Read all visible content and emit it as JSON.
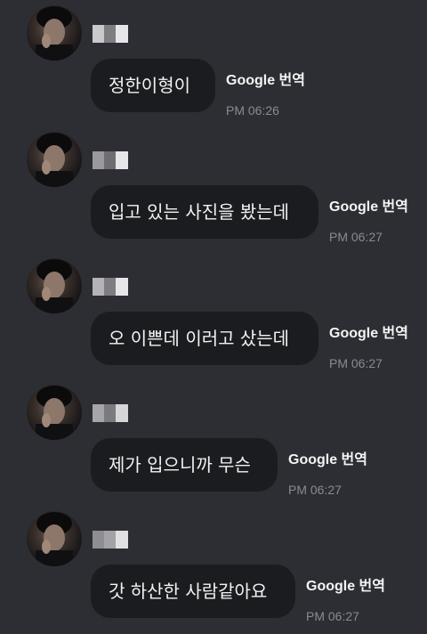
{
  "messages": [
    {
      "text": "정한이형이",
      "translate_label": "Google 번역",
      "time": "PM 06:26"
    },
    {
      "text": "입고 있는 사진을 봤는데",
      "translate_label": "Google 번역",
      "time": "PM 06:27"
    },
    {
      "text": "오 이쁜데 이러고 샀는데",
      "translate_label": "Google 번역",
      "time": "PM 06:27"
    },
    {
      "text": "제가 입으니까 무슨",
      "translate_label": "Google 번역",
      "time": "PM 06:27"
    },
    {
      "text": "갓 하산한 사람같아요",
      "translate_label": "Google 번역",
      "time": "PM 06:27"
    }
  ],
  "colors": {
    "background": "#2c2e33",
    "bubble": "#1b1c1f",
    "text": "#f2f2f2",
    "time": "#8a8a90"
  }
}
